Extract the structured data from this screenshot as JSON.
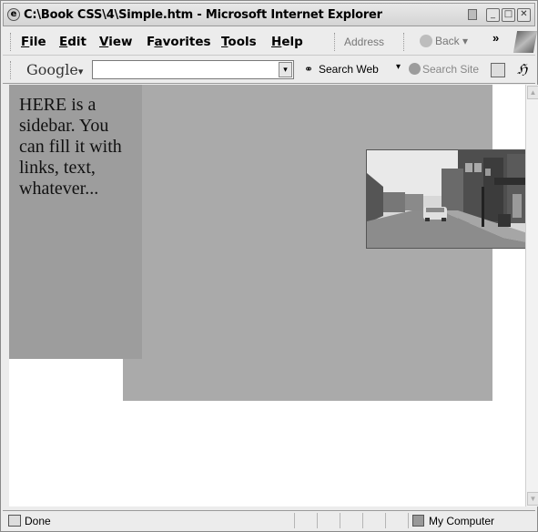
{
  "window": {
    "title": "C:\\Book CSS\\4\\Simple.htm - Microsoft Internet Explorer",
    "app_icon": "e"
  },
  "menubar": {
    "items": [
      {
        "label": "File",
        "accel": "F",
        "rest": "ile"
      },
      {
        "label": "Edit",
        "accel": "E",
        "rest": "dit"
      },
      {
        "label": "View",
        "accel": "V",
        "rest": "iew"
      },
      {
        "label": "Favorites",
        "accel": "a",
        "pre": "F",
        "rest": "vorites"
      },
      {
        "label": "Tools",
        "accel": "T",
        "rest": "ools"
      },
      {
        "label": "Help",
        "accel": "H",
        "rest": "elp"
      }
    ],
    "address_label": "Address",
    "back_label": "Back",
    "chevron": "»"
  },
  "google_toolbar": {
    "logo": "Google",
    "logo_caret": "▾",
    "search_value": "",
    "search_web_label": "Search Web",
    "search_site_label": "Search Site"
  },
  "content": {
    "sidebar_text": "HERE is a sidebar. You can fill it with links, text, whatever...",
    "colors": {
      "main_box": "#aaaaaa",
      "sidebar": "#9d9d9d"
    }
  },
  "statusbar": {
    "left_text": "Done",
    "right_text": "My Computer"
  },
  "icons": {
    "app": "ie-page-icon",
    "back": "back-arrow-icon",
    "windows_logo": "windows-flag-icon",
    "binoculars": "binoculars-icon",
    "search_site": "search-site-icon",
    "page_info": "page-info-icon",
    "highlight": "highlight-icon",
    "computer": "computer-icon"
  }
}
